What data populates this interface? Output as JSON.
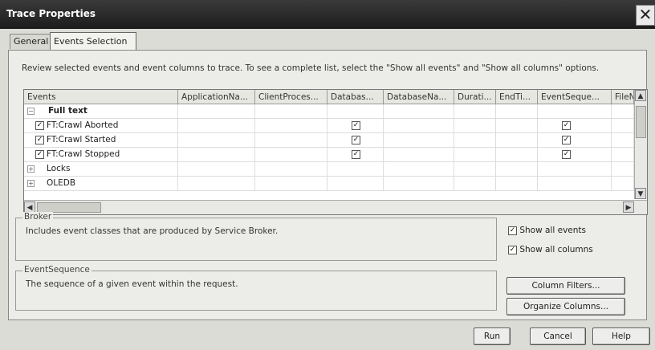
{
  "window": {
    "title": "Trace Properties",
    "close_glyph": "✕"
  },
  "tabs": [
    {
      "label": "General"
    },
    {
      "label": "Events Selection"
    }
  ],
  "instructions": "Review selected events and event columns to trace. To see a complete list, select the \"Show all events\" and \"Show all columns\" options.",
  "grid": {
    "columns": [
      "Events",
      "ApplicationNa...",
      "ClientProces...",
      "Databas...",
      "DatabaseNa...",
      "Durati...",
      "EndTi...",
      "EventSeque...",
      "FileN"
    ],
    "rows": [
      {
        "expander": "−",
        "label": "Full text",
        "bold": true,
        "checked": false,
        "checks": []
      },
      {
        "expander": "",
        "label": "FT:Crawl Aborted",
        "bold": false,
        "checked": true,
        "checks": [
          3,
          7
        ]
      },
      {
        "expander": "",
        "label": "FT:Crawl Started",
        "bold": false,
        "checked": true,
        "checks": [
          3,
          7
        ]
      },
      {
        "expander": "",
        "label": "FT:Crawl Stopped",
        "bold": false,
        "checked": true,
        "checks": [
          3,
          7
        ]
      },
      {
        "expander": "+",
        "label": "Locks",
        "bold": false,
        "checked": false,
        "checks": []
      },
      {
        "expander": "+",
        "label": "OLEDB",
        "bold": false,
        "checked": false,
        "checks": []
      }
    ],
    "check_glyph": "✓"
  },
  "broker": {
    "legend": "Broker",
    "text": "Includes event classes that are produced by Service Broker."
  },
  "event_sequence": {
    "legend": "EventSequence",
    "text": "The sequence of a given event within the request."
  },
  "options": {
    "show_all_events": "Show all events",
    "show_all_columns": "Show all columns"
  },
  "buttons": {
    "column_filters": "Column Filters...",
    "organize_columns": "Organize Columns...",
    "run": "Run",
    "cancel": "Cancel",
    "help": "Help"
  }
}
